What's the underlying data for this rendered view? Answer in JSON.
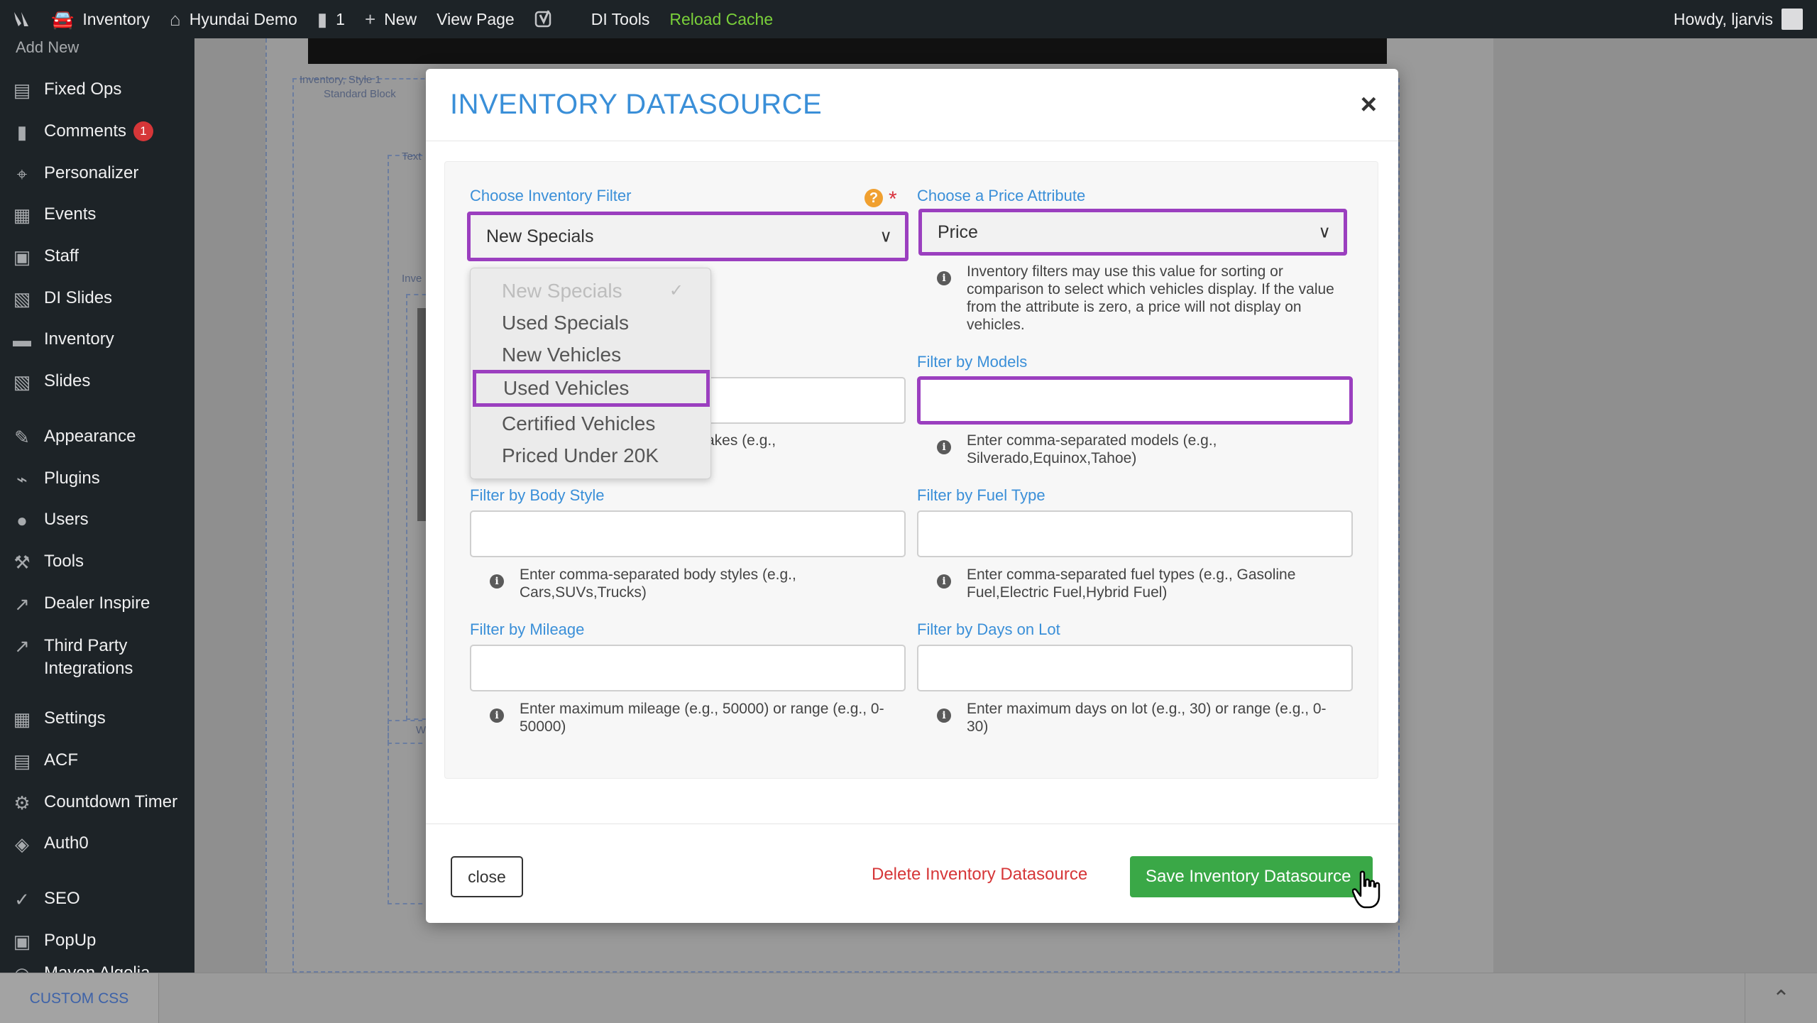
{
  "admin_bar": {
    "site_item": "Inventory",
    "site_name": "Hyundai Demo",
    "comments_count": "1",
    "new_label": "New",
    "view_page": "View Page",
    "di_tools": "DI Tools",
    "reload_cache": "Reload Cache",
    "greeting": "Howdy, ljarvis"
  },
  "sidebar": {
    "add_new": "Add New",
    "items": [
      {
        "label": "Fixed Ops",
        "icon": "fixed-ops-icon"
      },
      {
        "label": "Comments",
        "icon": "comment-icon",
        "badge": "1"
      },
      {
        "label": "Personalizer",
        "icon": "pin-icon"
      },
      {
        "label": "Events",
        "icon": "calendar-icon"
      },
      {
        "label": "Staff",
        "icon": "staff-icon"
      },
      {
        "label": "DI Slides",
        "icon": "slides-icon"
      },
      {
        "label": "Inventory",
        "icon": "car-icon"
      },
      {
        "label": "Slides",
        "icon": "slides-icon"
      },
      {
        "label": "Appearance",
        "icon": "brush-icon"
      },
      {
        "label": "Plugins",
        "icon": "plugin-icon"
      },
      {
        "label": "Users",
        "icon": "user-icon"
      },
      {
        "label": "Tools",
        "icon": "wrench-icon"
      },
      {
        "label": "Dealer Inspire",
        "icon": "chart-icon"
      },
      {
        "label": "Third Party Integrations",
        "icon": "integrations-icon"
      },
      {
        "label": "Settings",
        "icon": "settings-icon"
      },
      {
        "label": "ACF",
        "icon": "acf-icon"
      },
      {
        "label": "Countdown Timer",
        "icon": "gear-icon"
      },
      {
        "label": "Auth0",
        "icon": "shield-icon"
      },
      {
        "label": "SEO",
        "icon": "seo-icon"
      },
      {
        "label": "PopUp",
        "icon": "popup-icon"
      },
      {
        "label": "Maven Algolia",
        "icon": "algolia-icon"
      }
    ]
  },
  "canvas": {
    "block1": "Inventory, Style 1",
    "block2": "Standard Block",
    "block3": "Text",
    "block4": "Inve",
    "block5": "W"
  },
  "bottom_bar": {
    "custom_css": "CUSTOM CSS"
  },
  "modal": {
    "title": "INVENTORY DATASOURCE",
    "close_x": "×",
    "inventory_filter": {
      "label": "Choose Inventory Filter",
      "selected": "New Specials",
      "options": [
        {
          "label": "New Specials",
          "disabled": true,
          "selected": true
        },
        {
          "label": "Used Specials"
        },
        {
          "label": "New Vehicles"
        },
        {
          "label": "Used Vehicles",
          "highlighted": true
        },
        {
          "label": "Certified Vehicles"
        },
        {
          "label": "Priced Under 20K"
        }
      ]
    },
    "price_attribute": {
      "label": "Choose a Price Attribute",
      "selected": "Price",
      "help": "Inventory filters may use this value for sorting or comparison to select which vehicles display. If the value from the attribute is zero, a price will not display on vehicles."
    },
    "makes_help_partial": "akes (e.g.,",
    "filter_models": {
      "label": "Filter by Models",
      "value": "",
      "help": "Enter comma-separated models (e.g., Silverado,Equinox,Tahoe)"
    },
    "filter_body": {
      "label": "Filter by Body Style",
      "value": "",
      "help": "Enter comma-separated body styles (e.g., Cars,SUVs,Trucks)"
    },
    "filter_fuel": {
      "label": "Filter by Fuel Type",
      "value": "",
      "help": "Enter comma-separated fuel types (e.g., Gasoline Fuel,Electric Fuel,Hybrid Fuel)"
    },
    "filter_mileage": {
      "label": "Filter by Mileage",
      "value": "",
      "help": "Enter maximum mileage (e.g., 50000) or range (e.g., 0-50000)"
    },
    "filter_days": {
      "label": "Filter by Days on Lot",
      "value": "",
      "help": "Enter maximum days on lot (e.g., 30) or range (e.g., 0-30)"
    },
    "buttons": {
      "close": "close",
      "delete": "Delete Inventory Datasource",
      "save": "Save Inventory Datasource"
    }
  },
  "colors": {
    "accent_blue": "#3a8fd8",
    "highlight_purple": "#9b3fbf",
    "save_green": "#3aa847",
    "delete_red": "#d63638",
    "reload_green": "#7ad03a"
  }
}
